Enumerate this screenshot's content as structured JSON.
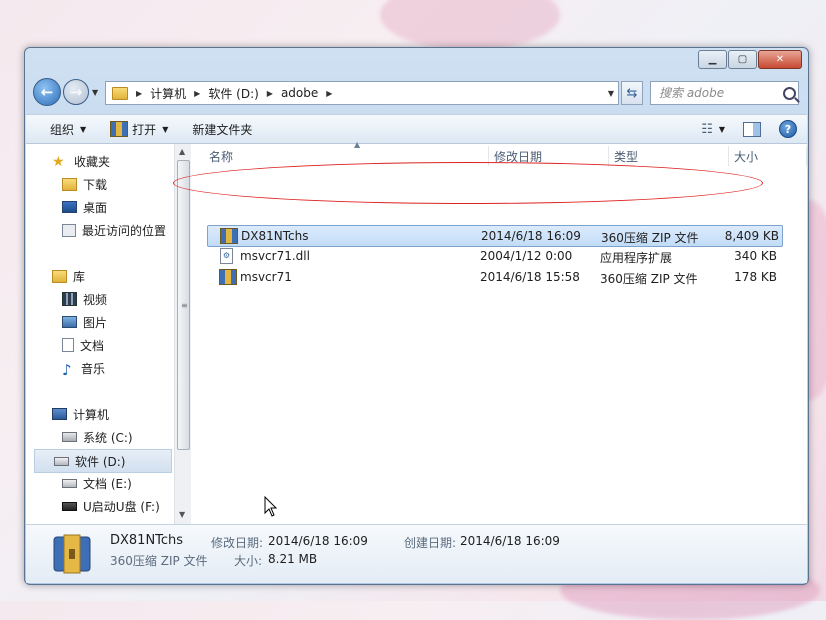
{
  "address": {
    "crumbs": [
      "计算机",
      "软件 (D:)",
      "adobe"
    ],
    "search_placeholder": "搜索 adobe"
  },
  "toolbar": {
    "organize": "组织",
    "open": "打开",
    "new_folder": "新建文件夹"
  },
  "sidebar": {
    "favorites": "收藏夹",
    "favorites_items": [
      "下载",
      "桌面",
      "最近访问的位置"
    ],
    "libraries": "库",
    "library_items": [
      "视频",
      "图片",
      "文档",
      "音乐"
    ],
    "computer": "计算机",
    "drives": [
      "系统 (C:)",
      "软件 (D:)",
      "文档 (E:)",
      "U启动U盘 (F:)"
    ],
    "selected_drive": "软件 (D:)"
  },
  "columns": {
    "name": "名称",
    "modified": "修改日期",
    "type": "类型",
    "size": "大小"
  },
  "files": [
    {
      "name": "DX81NTchs",
      "modified": "2014/6/18 16:09",
      "type": "360压缩 ZIP 文件",
      "size": "8,409 KB",
      "icon": "zip-icon",
      "selected": true
    },
    {
      "name": "msvcr71.dll",
      "modified": "2004/1/12 0:00",
      "type": "应用程序扩展",
      "size": "340 KB",
      "icon": "dll-icon",
      "selected": false
    },
    {
      "name": "msvcr71",
      "modified": "2014/6/18 15:58",
      "type": "360压缩 ZIP 文件",
      "size": "178 KB",
      "icon": "zip-icon",
      "selected": false
    }
  ],
  "details": {
    "name": "DX81NTchs",
    "type": "360压缩 ZIP 文件",
    "modified_label": "修改日期:",
    "modified": "2014/6/18 16:09",
    "created_label": "创建日期:",
    "created": "2014/6/18 16:09",
    "size_label": "大小:",
    "size": "8.21 MB"
  },
  "colors": {
    "selection": "#c2dcf7",
    "annotation_ring": "#dd2222",
    "window_frame": "#b9d1ea"
  }
}
